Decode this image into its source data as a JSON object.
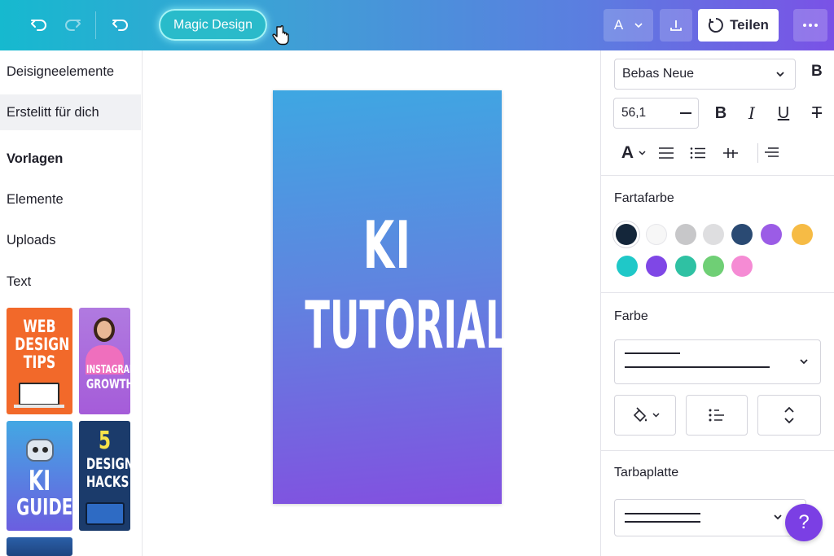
{
  "topbar": {
    "magic_design_label": "Magic Design",
    "font_button_label": "A",
    "share_label": "Teilen",
    "icons": [
      "undo-icon",
      "redo-icon",
      "undo-alt-icon",
      "download-icon",
      "share-icon",
      "more-icon"
    ]
  },
  "sidebar": {
    "items": [
      {
        "label": "Deisigneelemente"
      },
      {
        "label": "Erstelitt für dich"
      },
      {
        "label": "Vorlagen"
      },
      {
        "label": "Elemente"
      },
      {
        "label": "Uploads"
      },
      {
        "label": "Text"
      }
    ],
    "thumbnails": [
      {
        "lines": [
          "WEB",
          "DESIGN",
          "TIPS"
        ],
        "color": "#f2692a"
      },
      {
        "lines": [
          "INSTAGRAM",
          "GROWTH"
        ],
        "color": "#b36ad8"
      },
      {
        "lines": [
          "KI",
          "GUIDE"
        ],
        "color": "#4a78d9"
      },
      {
        "lines": [
          "5",
          "DESIGN",
          "HACKS"
        ],
        "color": "#1b3b6b"
      }
    ]
  },
  "canvas": {
    "line1": "KI",
    "line2": "TUTORIAL"
  },
  "panel": {
    "font_name": "Bebas Neue",
    "bold_short": "B",
    "font_size": "56,1",
    "format_labels": {
      "bold": "B",
      "italic": "I",
      "underline": "U",
      "strike": "T"
    },
    "color_label_glyph": "A",
    "text_color_title": "Fartafarbe",
    "swatches": [
      "#14263a",
      "#f7f7f7",
      "#c7c7c9",
      "#dedee0",
      "#2a4a73",
      "#9b5ce6",
      "#f6bb45",
      "#1fc8c8",
      "#7f47e6",
      "#2fc1a3",
      "#6fcf75",
      "#f58bd4"
    ],
    "color_title": "Farbe",
    "palette_title": "Tarbaplatte",
    "help_label": "?"
  }
}
